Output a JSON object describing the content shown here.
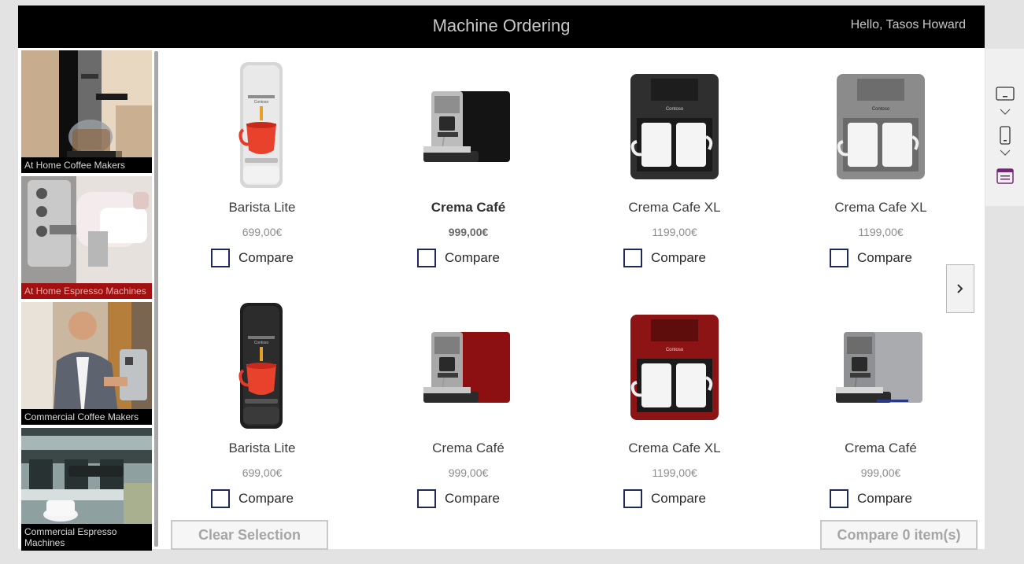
{
  "header": {
    "title": "Machine Ordering",
    "greeting": "Hello, Tasos Howard",
    "background": "#000000"
  },
  "sidebar": {
    "categories": [
      {
        "label": "At Home Coffee Makers",
        "selected": false
      },
      {
        "label": "At Home Espresso Machines",
        "selected": true
      },
      {
        "label": "Commercial Coffee Makers",
        "selected": false
      },
      {
        "label": "Commercial Espresso Machines",
        "selected": false
      }
    ],
    "selected_color": "#a40f0f"
  },
  "products": [
    {
      "name": "Barista Lite",
      "price": "699,00€",
      "compare_label": "Compare",
      "checked": false,
      "selected": false,
      "image": "pod-machine-silver"
    },
    {
      "name": "Crema Café",
      "price": "999,00€",
      "compare_label": "Compare",
      "checked": false,
      "selected": true,
      "image": "espresso-machine-black"
    },
    {
      "name": "Crema Cafe XL",
      "price": "1199,00€",
      "compare_label": "Compare",
      "checked": false,
      "selected": false,
      "image": "dual-cup-machine-black"
    },
    {
      "name": "Crema Cafe XL",
      "price": "1199,00€",
      "compare_label": "Compare",
      "checked": false,
      "selected": false,
      "image": "dual-cup-machine-grey"
    },
    {
      "name": "Barista Lite",
      "price": "699,00€",
      "compare_label": "Compare",
      "checked": false,
      "selected": false,
      "image": "pod-machine-black"
    },
    {
      "name": "Crema Café",
      "price": "999,00€",
      "compare_label": "Compare",
      "checked": false,
      "selected": false,
      "image": "espresso-machine-red"
    },
    {
      "name": "Crema Cafe XL",
      "price": "1199,00€",
      "compare_label": "Compare",
      "checked": false,
      "selected": false,
      "image": "dual-cup-machine-red"
    },
    {
      "name": "Crema Café",
      "price": "999,00€",
      "compare_label": "Compare",
      "checked": false,
      "selected": false,
      "image": "espresso-machine-silver"
    }
  ],
  "actions": {
    "clear_label": "Clear Selection",
    "compare_label": "Compare 0 item(s)"
  },
  "right_rail": {
    "icons": [
      "tablet-layout-icon",
      "chevron-down-icon",
      "phone-layout-icon",
      "chevron-down-icon",
      "form-layout-icon"
    ]
  }
}
